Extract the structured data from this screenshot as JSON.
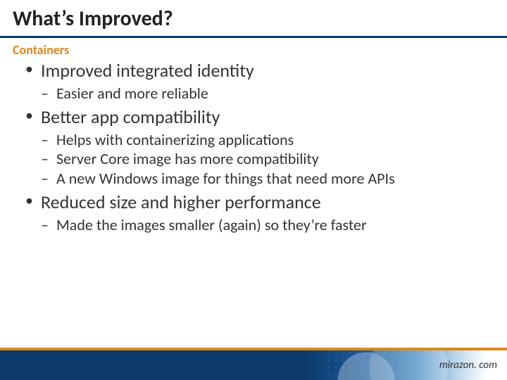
{
  "title": "What’s Improved?",
  "subtitle": "Containers",
  "bullets": [
    {
      "text": "Improved integrated identity",
      "children": [
        {
          "text": "Easier and more reliable"
        }
      ]
    },
    {
      "text": "Better app compatibility",
      "children": [
        {
          "text": "Helps with containerizing applications"
        },
        {
          "text": "Server Core image has more compatibility"
        },
        {
          "text": "A new Windows image for things that need more APIs"
        }
      ]
    },
    {
      "text": "Reduced size and higher performance",
      "children": [
        {
          "text": "Made the images smaller (again) so they’re faster"
        }
      ]
    }
  ],
  "footer": {
    "url": "mirazon. com"
  }
}
